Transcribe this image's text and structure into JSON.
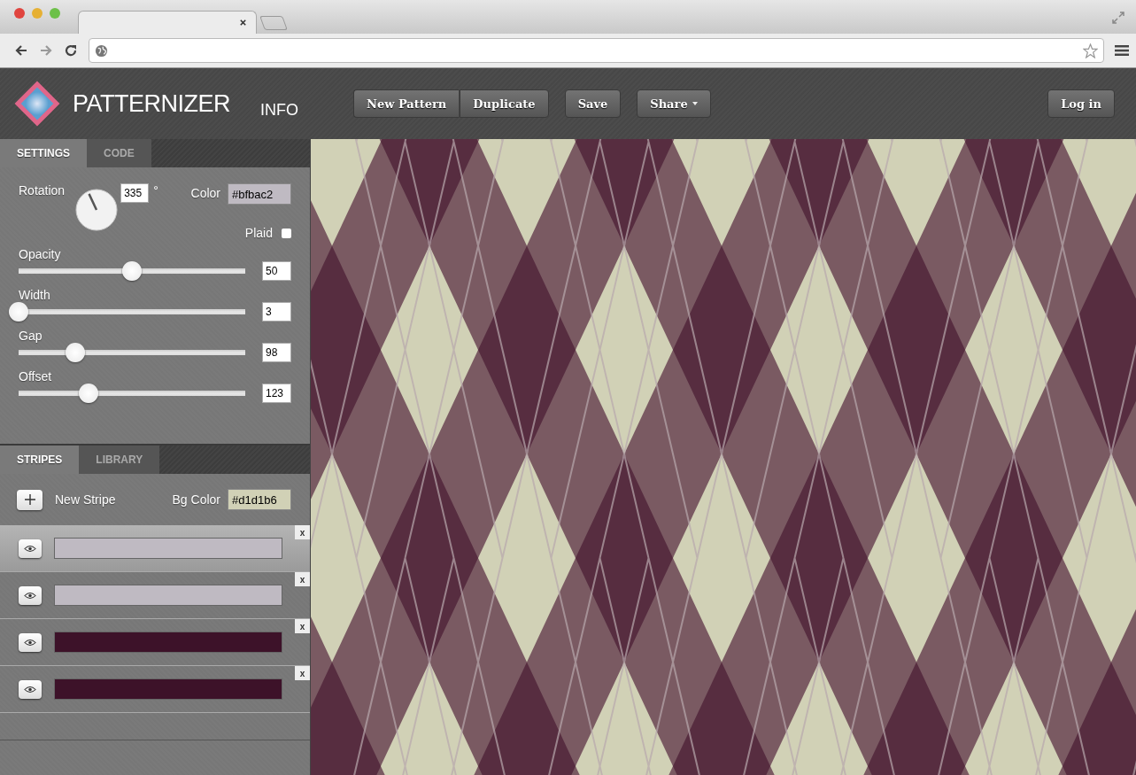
{
  "app": {
    "logo_text": "PATTERNIZER",
    "info_link": "INFO"
  },
  "toolbar": {
    "groups": [
      {
        "buttons": [
          {
            "label": "New Pattern",
            "dropdown": false
          },
          {
            "label": "Duplicate",
            "dropdown": false
          }
        ]
      },
      {
        "buttons": [
          {
            "label": "Save",
            "dropdown": false
          }
        ]
      },
      {
        "buttons": [
          {
            "label": "Share",
            "dropdown": true
          }
        ]
      }
    ],
    "login": "Log in"
  },
  "settings": {
    "tabs": [
      {
        "label": "SETTINGS",
        "selected": true
      },
      {
        "label": "CODE",
        "selected": false
      }
    ],
    "rotation": {
      "label": "Rotation",
      "value": "335",
      "unit": "°"
    },
    "color": {
      "label": "Color",
      "value": "#bfbac2"
    },
    "plaid": {
      "label": "Plaid",
      "checked": false
    },
    "sliders": [
      {
        "label": "Opacity",
        "level": 0.5,
        "value": "50"
      },
      {
        "label": "Width",
        "level": 0.0,
        "value": "3"
      },
      {
        "label": "Gap",
        "level": 0.25,
        "value": "98"
      },
      {
        "label": "Offset",
        "level": 0.31,
        "value": "123"
      }
    ]
  },
  "stripes": {
    "tabs": [
      {
        "label": "STRIPES",
        "selected": true
      },
      {
        "label": "LIBRARY",
        "selected": false
      }
    ],
    "new_stripe": "New Stripe",
    "bg_color": {
      "label": "Bg Color",
      "value": "#d1d1b6"
    },
    "items": [
      {
        "color": "#bfbac2",
        "selected": true,
        "delete": "x"
      },
      {
        "color": "#bfbac2",
        "selected": false,
        "delete": "x"
      },
      {
        "color": "#3d1229",
        "selected": false,
        "delete": "x"
      },
      {
        "color": "#3d1229",
        "selected": false,
        "delete": "x"
      }
    ]
  }
}
